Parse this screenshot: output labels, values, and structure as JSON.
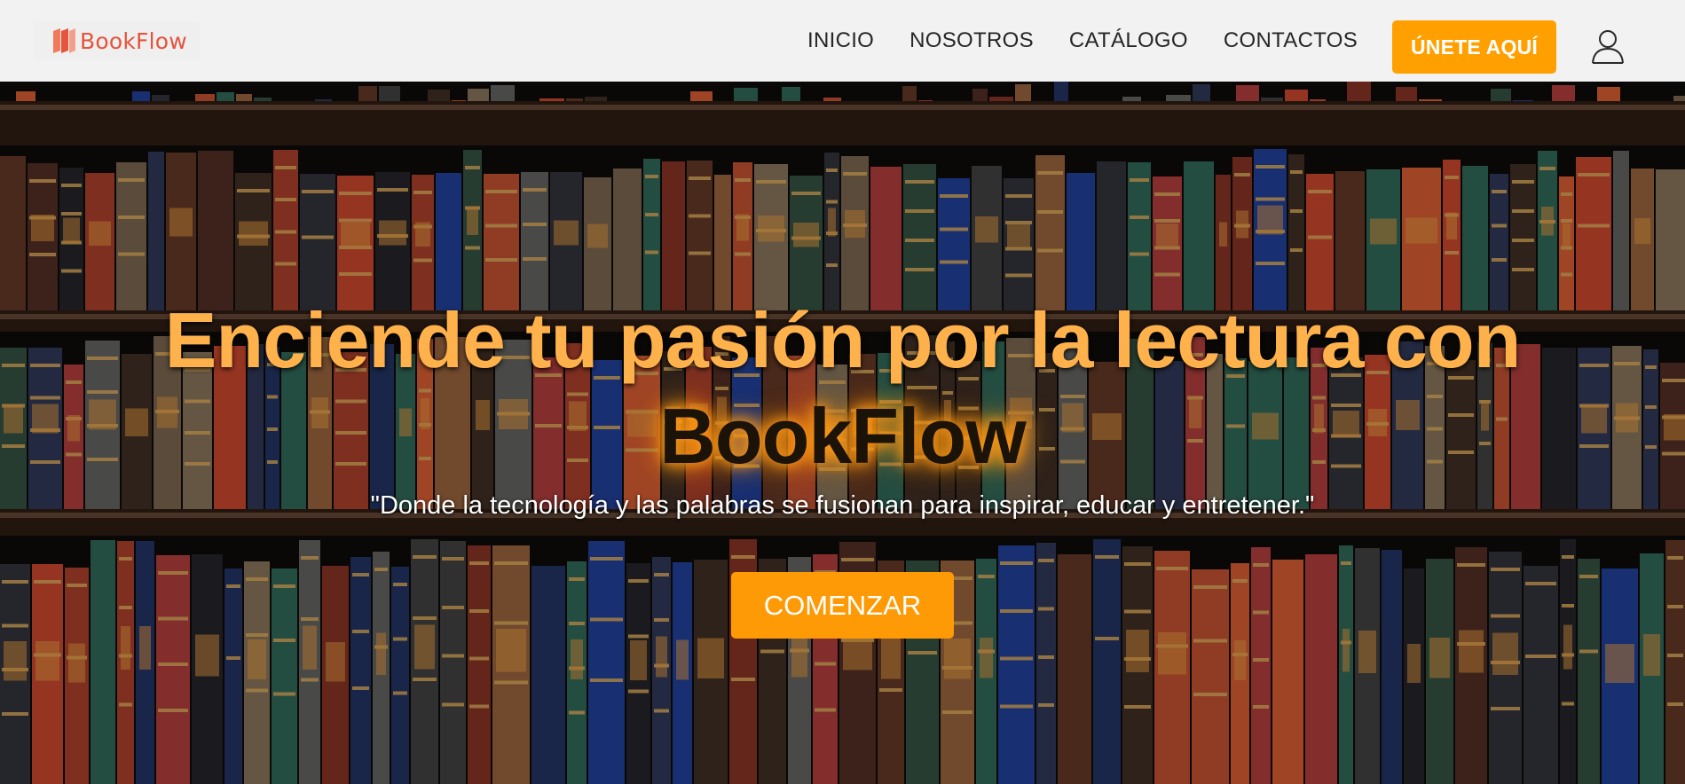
{
  "brand": {
    "name": "BookFlow"
  },
  "nav": {
    "links": [
      "INICIO",
      "NOSOTROS",
      "CATÁLOGO",
      "CONTACTOS"
    ],
    "cta_label": "ÚNETE AQUÍ",
    "user_icon": "user-icon"
  },
  "hero": {
    "headline_main": "Enciende tu pasión por la lectura con",
    "headline_brand": "BookFlow",
    "tagline": "\"Donde la tecnología y las palabras se fusionan para inspirar, educar y entretener.\"",
    "button_label": "COMENZAR",
    "background": "bookshelf-image"
  },
  "colors": {
    "accent": "#ffa000",
    "logo": "#e5543c",
    "headline": "#ffb24c",
    "navbar_bg": "#f2f2f2"
  }
}
